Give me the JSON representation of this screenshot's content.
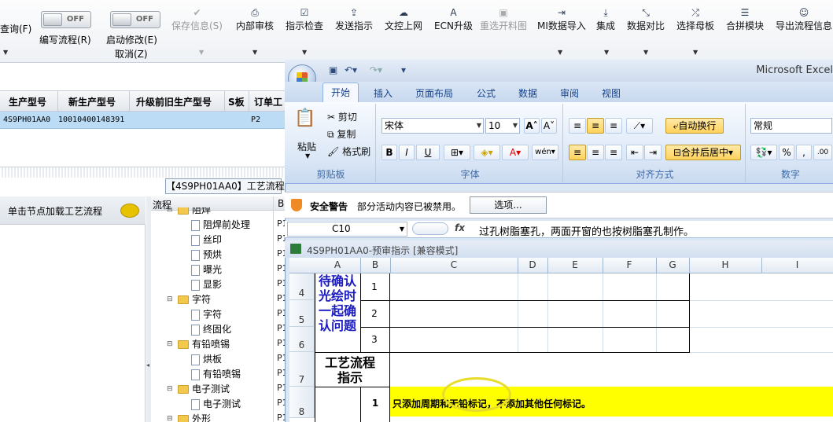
{
  "toolbar": {
    "query_label": "查询(F)",
    "edit_flow_toggle": "OFF",
    "edit_flow_label": "编写流程(R)",
    "start_modify_toggle": "OFF",
    "start_modify_label": "启动修改(E)",
    "cancel_label": "取消(Z)",
    "buttons": [
      {
        "label": "保存信息(S)",
        "icon": "check-icon"
      },
      {
        "label": "内部审核",
        "icon": "printer-icon"
      },
      {
        "label": "指示检查",
        "icon": "checkbox-icon"
      },
      {
        "label": "发送指示",
        "icon": "upload-icon"
      },
      {
        "label": "文控上网",
        "icon": "cloud-upload-icon"
      },
      {
        "label": "ECN升级",
        "icon": "font-icon"
      },
      {
        "label": "重选开料图",
        "icon": "picture-icon"
      },
      {
        "label": "MI数据导入",
        "icon": "import-icon"
      },
      {
        "label": "集成",
        "icon": "download-icon"
      },
      {
        "label": "数据对比",
        "icon": "compress-icon"
      },
      {
        "label": "选择母板",
        "icon": "shuffle-icon"
      },
      {
        "label": "合拼模块",
        "icon": "list-icon"
      },
      {
        "label": "导出流程信息",
        "icon": "smile-icon"
      }
    ]
  },
  "grid": {
    "columns": [
      "生产型号",
      "新生产型号",
      "升级前旧生产型号",
      "S板",
      "订单工"
    ],
    "row": {
      "model": "4S9PH01AA0",
      "new_model": "10010400148391",
      "sboard": "P2"
    }
  },
  "process_tab": "【4S9PH01AA0】工艺流程",
  "left_panel": {
    "title": "单击节点加载工艺流程"
  },
  "tree": {
    "col1": "流程",
    "col2": "B",
    "nodes": [
      {
        "label": "阻焊",
        "type": "folder"
      },
      {
        "label": "阻焊前处理",
        "type": "file"
      },
      {
        "label": "丝印",
        "type": "file"
      },
      {
        "label": "预烘",
        "type": "file"
      },
      {
        "label": "曝光",
        "type": "file"
      },
      {
        "label": "显影",
        "type": "file"
      },
      {
        "label": "字符",
        "type": "folder"
      },
      {
        "label": "字符",
        "type": "file"
      },
      {
        "label": "终固化",
        "type": "file"
      },
      {
        "label": "有铅喷锡",
        "type": "folder"
      },
      {
        "label": "烘板",
        "type": "file"
      },
      {
        "label": "有铅喷锡",
        "type": "file"
      },
      {
        "label": "电子测试",
        "type": "folder"
      },
      {
        "label": "电子测试",
        "type": "file"
      },
      {
        "label": "外形",
        "type": "folder"
      }
    ],
    "col2_values": [
      "P1",
      "P1",
      "P1",
      "P1",
      "P1",
      "P1",
      "P1",
      "P1",
      "P1",
      "P1",
      "P1",
      "P1",
      "P1",
      "P1"
    ]
  },
  "excel": {
    "app_title": "Microsoft Excel",
    "tabs": [
      "开始",
      "插入",
      "页面布局",
      "公式",
      "数据",
      "审阅",
      "视图"
    ],
    "clipboard": {
      "paste": "粘贴",
      "cut": "剪切",
      "copy": "复制",
      "format_painter": "格式刷",
      "group": "剪贴板"
    },
    "font": {
      "name": "宋体",
      "size": "10",
      "group": "字体",
      "bold": "B",
      "italic": "I",
      "underline": "U"
    },
    "alignment": {
      "wrap": "自动换行",
      "merge": "合并后居中",
      "group": "对齐方式"
    },
    "number": {
      "format": "常规",
      "percent": "%",
      "comma": ",",
      "group": "数字"
    },
    "security": {
      "title": "安全警告",
      "message": "部分活动内容已被禁用。",
      "options": "选项..."
    },
    "formula_bar": {
      "cell": "C10",
      "fx": "fx",
      "content": "过孔树脂塞孔，两面开窗的也按树脂塞孔制作。"
    },
    "workbook_title": "4S9PH01AA0-预审指示  [兼容模式]",
    "columns": [
      "A",
      "B",
      "C",
      "D",
      "E",
      "F",
      "G",
      "H",
      "I"
    ],
    "rows": [
      "4",
      "5",
      "6",
      "7",
      "8"
    ],
    "confirm_text": "待确认光绘时一起确认问题",
    "nums": [
      "1",
      "2",
      "3"
    ],
    "process_label": "工艺流程指示",
    "row8_num": "1",
    "instruction": "只添加周期和无铅标记，不添加其他任何标记。",
    "highlight_color": "#ffff00"
  }
}
